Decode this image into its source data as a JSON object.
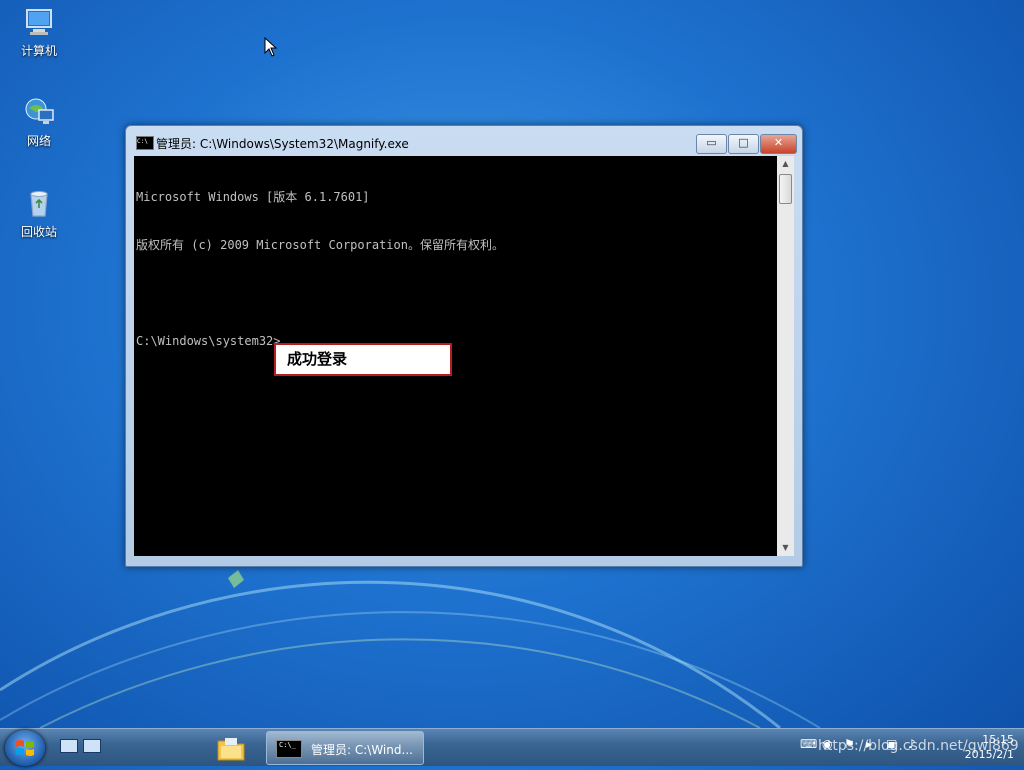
{
  "desktop": {
    "icons": [
      {
        "label": "计算机",
        "icon": "computer-icon"
      },
      {
        "label": "网络",
        "icon": "network-icon"
      },
      {
        "label": "回收站",
        "icon": "recycle-bin-icon"
      }
    ]
  },
  "window": {
    "title": "管理员: C:\\Windows\\System32\\Magnify.exe",
    "icon_text": "C:\\",
    "minimize_glyph": "▭",
    "maximize_glyph": "□",
    "close_glyph": "✕",
    "console_lines": [
      "Microsoft Windows [版本 6.1.7601]",
      "版权所有 (c) 2009 Microsoft Corporation。保留所有权利。",
      "",
      "C:\\Windows\\system32>"
    ],
    "scroll_up": "▲",
    "scroll_down": "▼"
  },
  "callout": {
    "text": "成功登录"
  },
  "taskbar": {
    "task_label": "管理员: C:\\Wind...",
    "task_icon_text": "C:\\_",
    "clock_time": "15:15",
    "clock_date": "2015/2/1",
    "watermark": "https://blog.csdn.net/qwl869"
  },
  "colors": {
    "desktop": "#1e72cf",
    "console_bg": "#000000",
    "console_text": "#c0c0c0",
    "callout_border": "#b41e1e"
  }
}
